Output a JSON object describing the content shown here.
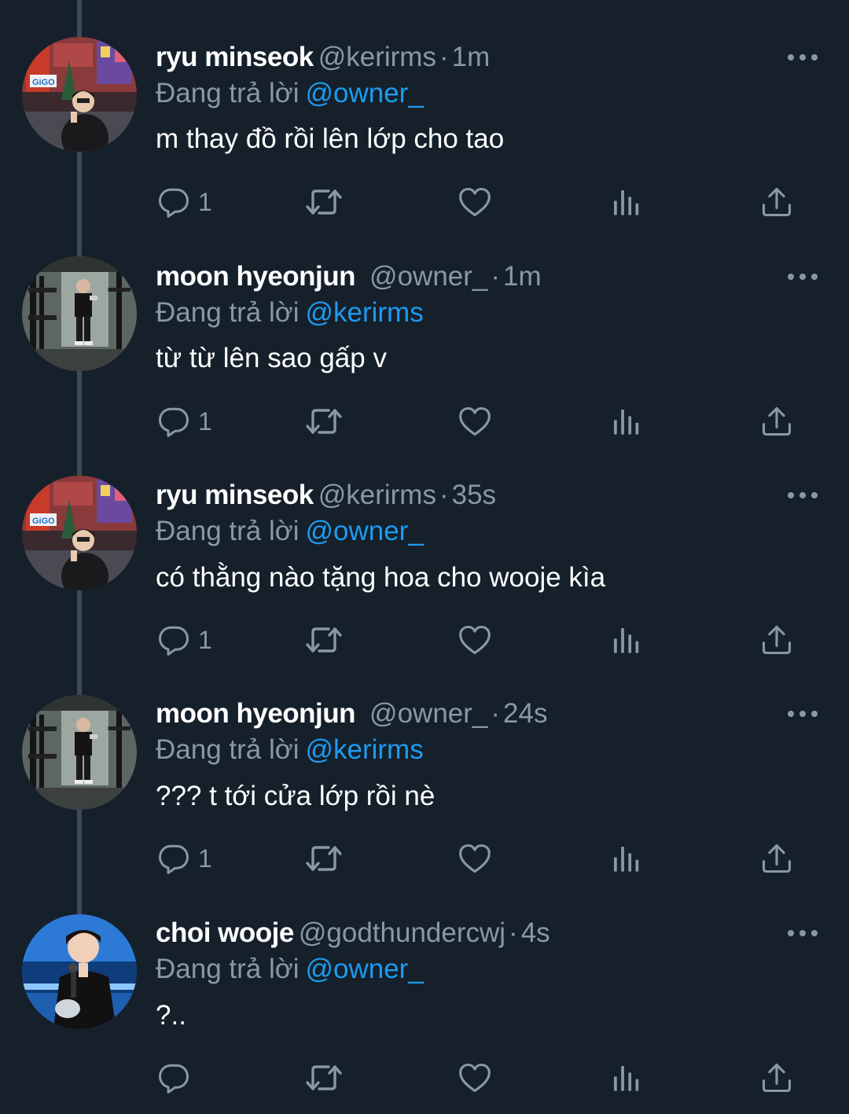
{
  "reply_prefix": "Đang trả lời",
  "tweets": [
    {
      "name": "ryu minseok",
      "handle": "@kerirms",
      "separator": "·",
      "time": "1m",
      "replying_to": "@owner_",
      "text": "m thay đồ rồi lên lớp cho tao",
      "reply_count": "1",
      "avatar": "avatar-ryu"
    },
    {
      "name": "moon hyeonjun",
      "handle": "@owner_",
      "separator": "·",
      "time": "1m",
      "replying_to": "@kerirms",
      "text": "từ từ lên sao gấp v",
      "reply_count": "1",
      "avatar": "avatar-moon"
    },
    {
      "name": "ryu minseok",
      "handle": "@kerirms",
      "separator": "·",
      "time": "35s",
      "replying_to": "@owner_",
      "text": "có thằng nào tặng hoa cho wooje kìa",
      "reply_count": "1",
      "avatar": "avatar-ryu"
    },
    {
      "name": "moon hyeonjun",
      "handle": "@owner_",
      "separator": "·",
      "time": "24s",
      "replying_to": "@kerirms",
      "text": "??? t tới cửa lớp rồi nè",
      "reply_count": "1",
      "avatar": "avatar-moon"
    },
    {
      "name": "choi wooje",
      "handle": "@godthundercwj",
      "separator": "·",
      "time": "4s",
      "replying_to": "@owner_",
      "text": "?..",
      "reply_count": "",
      "avatar": "avatar-choi"
    }
  ],
  "icons": {
    "reply": "reply-icon",
    "retweet": "retweet-icon",
    "like": "like-icon",
    "stats": "stats-icon",
    "share": "share-icon",
    "more": "more-icon"
  },
  "colors": {
    "background": "#15202b",
    "muted": "#8899a6",
    "mention": "#1d9bf0",
    "thread_line": "#3d4a57"
  }
}
